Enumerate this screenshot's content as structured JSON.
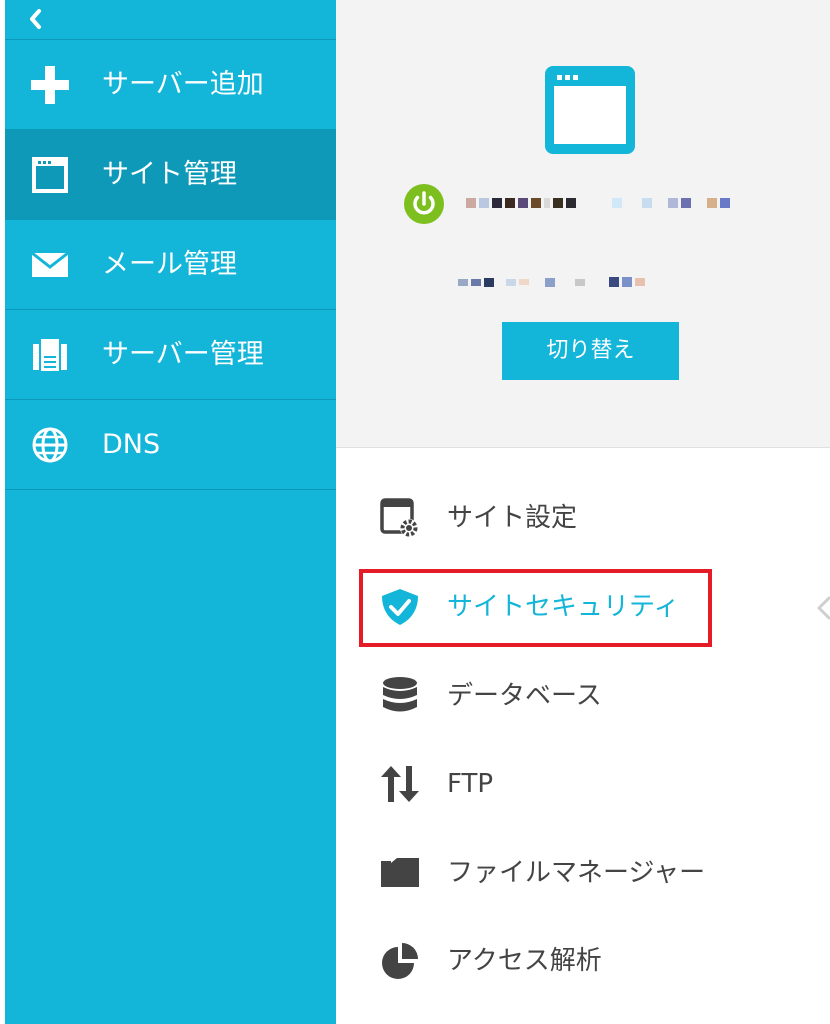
{
  "colors": {
    "sidebar_bg": "#13b5d9",
    "sidebar_active": "#0f99b8",
    "accent": "#13b5d9",
    "power_green": "#7cbf1f",
    "highlight_red": "#e31c25"
  },
  "sidebar": {
    "collapse_icon": "chevron-left-icon",
    "items": [
      {
        "label": "サーバー追加",
        "icon": "plus-icon"
      },
      {
        "label": "サイト管理",
        "icon": "window-icon",
        "active": true
      },
      {
        "label": "メール管理",
        "icon": "envelope-icon"
      },
      {
        "label": "サーバー管理",
        "icon": "server-icon"
      },
      {
        "label": "DNS",
        "icon": "globe-icon"
      }
    ]
  },
  "site_panel": {
    "icon": "window-icon",
    "status_icon": "power-icon",
    "switch_label": "切り替え"
  },
  "menu": {
    "items": [
      {
        "label": "サイト設定",
        "icon": "window-gear-icon"
      },
      {
        "label": "サイトセキュリティ",
        "icon": "shield-check-icon",
        "selected": true
      },
      {
        "label": "データベース",
        "icon": "database-icon"
      },
      {
        "label": "FTP",
        "icon": "transfer-arrows-icon"
      },
      {
        "label": "ファイルマネージャー",
        "icon": "folder-icon"
      },
      {
        "label": "アクセス解析",
        "icon": "pie-chart-icon"
      }
    ]
  }
}
